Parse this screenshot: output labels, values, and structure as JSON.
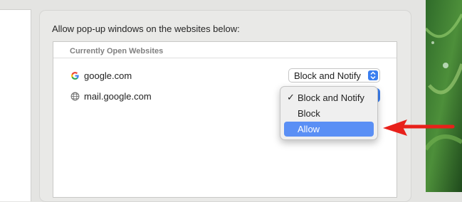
{
  "heading": "Allow pop-up windows on the websites below:",
  "section_header": "Currently Open Websites",
  "sites": [
    {
      "domain": "google.com",
      "icon": "google-g-icon",
      "setting": "Block and Notify"
    },
    {
      "domain": "mail.google.com",
      "icon": "globe-icon",
      "setting": "Block and Notify"
    }
  ],
  "dropdown": {
    "options": [
      {
        "label": "Block and Notify",
        "checked": true,
        "highlighted": false
      },
      {
        "label": "Block",
        "checked": false,
        "highlighted": false
      },
      {
        "label": "Allow",
        "checked": false,
        "highlighted": true
      }
    ],
    "check_glyph": "✓"
  },
  "colors": {
    "accent": "#3b7ff0",
    "highlight": "#5a8ff5",
    "annotation_arrow": "#e8201a"
  }
}
